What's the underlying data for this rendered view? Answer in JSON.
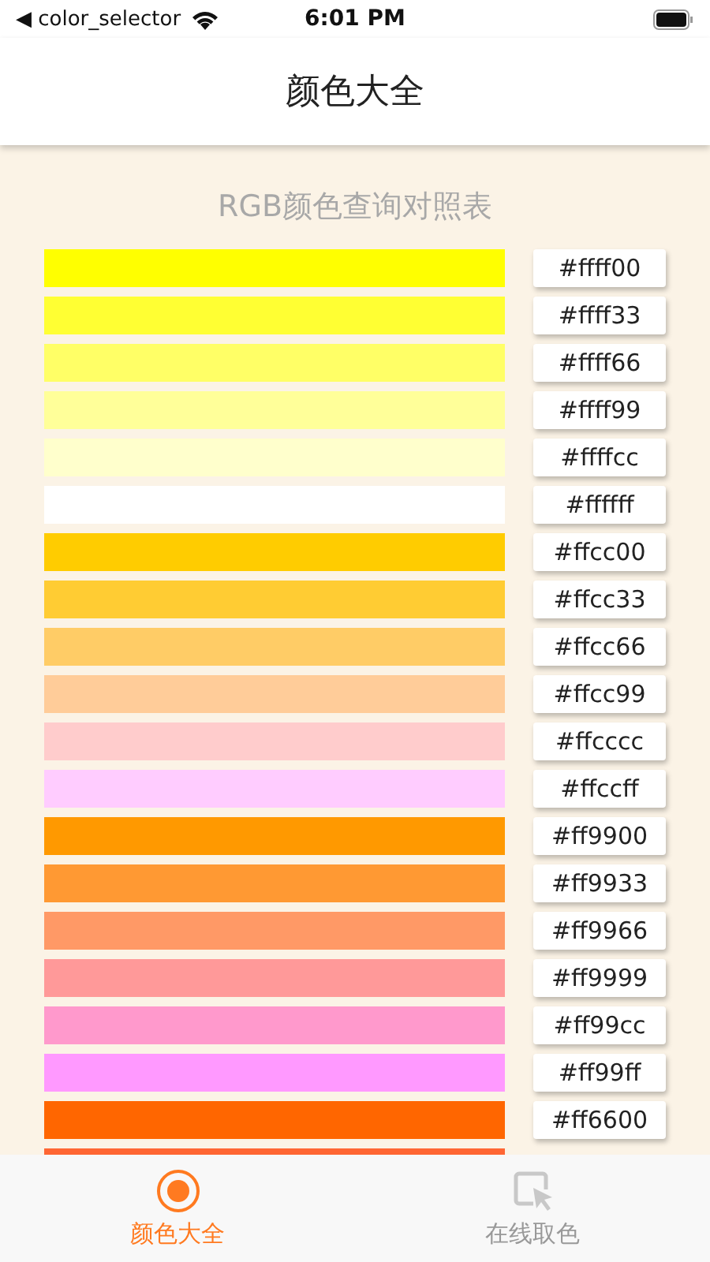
{
  "status_bar": {
    "back_label": "◀ color_selector",
    "time": "6:01 PM"
  },
  "nav": {
    "title": "颜色大全"
  },
  "heading": "RGB颜色查询对照表",
  "colors": [
    {
      "color": "#ffff00",
      "label": "#ffff00"
    },
    {
      "color": "#ffff33",
      "label": "#ffff33"
    },
    {
      "color": "#ffff66",
      "label": "#ffff66"
    },
    {
      "color": "#ffff99",
      "label": "#ffff99"
    },
    {
      "color": "#ffffcc",
      "label": "#ffffcc"
    },
    {
      "color": "#ffffff",
      "label": "#ffffff"
    },
    {
      "color": "#ffcc00",
      "label": "#ffcc00"
    },
    {
      "color": "#ffcc33",
      "label": "#ffcc33"
    },
    {
      "color": "#ffcc66",
      "label": "#ffcc66"
    },
    {
      "color": "#ffcc99",
      "label": "#ffcc99"
    },
    {
      "color": "#ffcccc",
      "label": "#ffcccc"
    },
    {
      "color": "#ffccff",
      "label": "#ffccff"
    },
    {
      "color": "#ff9900",
      "label": "#ff9900"
    },
    {
      "color": "#ff9933",
      "label": "#ff9933"
    },
    {
      "color": "#ff9966",
      "label": "#ff9966"
    },
    {
      "color": "#ff9999",
      "label": "#ff9999"
    },
    {
      "color": "#ff99cc",
      "label": "#ff99cc"
    },
    {
      "color": "#ff99ff",
      "label": "#ff99ff"
    },
    {
      "color": "#ff6600",
      "label": "#ff6600"
    },
    {
      "color": "#ff6633"
    }
  ],
  "tabs": [
    {
      "kind": "palette",
      "label": "颜色大全",
      "selected": true
    },
    {
      "kind": "picker",
      "label": "在线取色",
      "selected": false
    }
  ]
}
